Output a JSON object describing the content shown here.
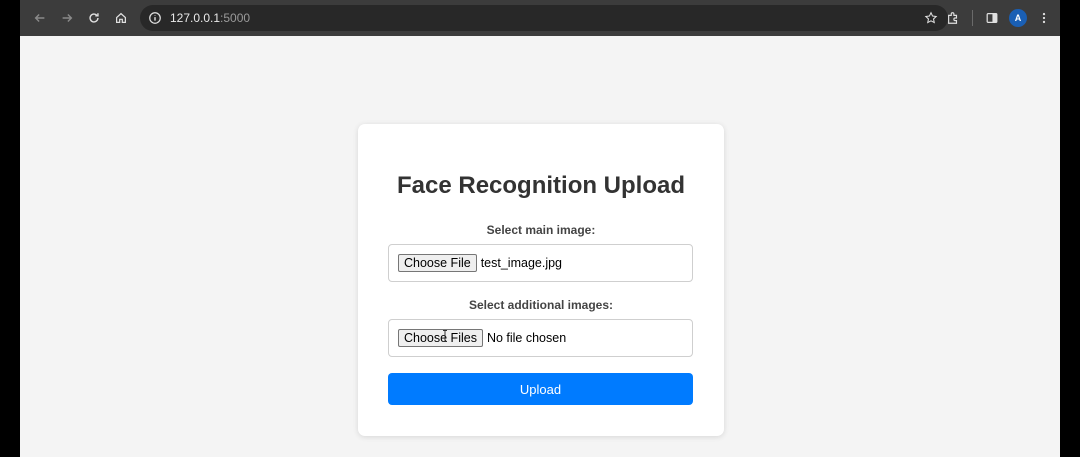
{
  "browser": {
    "url_host": "127.0.0.1",
    "url_port": ":5000",
    "avatar_letter": "A",
    "icons": [
      "back-icon",
      "forward-icon",
      "reload-icon",
      "home-icon",
      "site-info-icon",
      "bookmark-star-icon",
      "extensions-icon",
      "side-panel-icon",
      "profile-avatar",
      "more-menu-icon"
    ]
  },
  "page": {
    "title": "Face Recognition Upload",
    "main_image": {
      "label": "Select main image:",
      "button_label": "Choose File",
      "file_name": "test_image.jpg"
    },
    "additional_images": {
      "label": "Select additional images:",
      "button_label": "Choose Files",
      "file_name": "No file chosen"
    },
    "upload_label": "Upload"
  },
  "colors": {
    "accent": "#007bff",
    "page_background": "#f4f4f4",
    "card_background": "#ffffff",
    "chrome_background": "#3c3c3c"
  }
}
